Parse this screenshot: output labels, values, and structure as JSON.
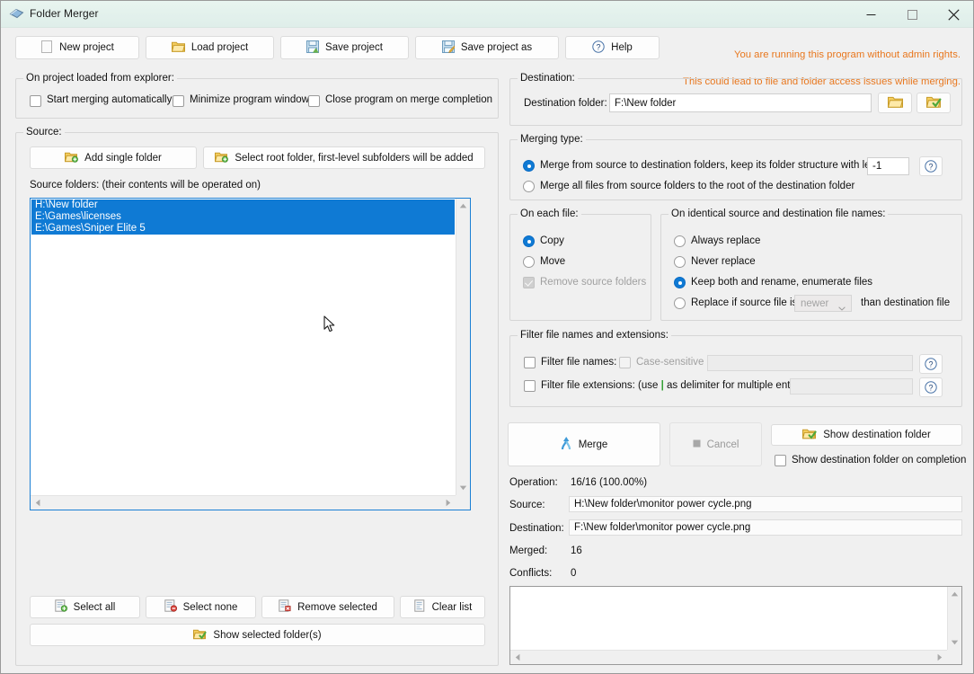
{
  "window": {
    "title": "Folder Merger",
    "icon": "folder-merger-icon",
    "minimize": "minimize-icon",
    "maximize": "maximize-icon",
    "close": "close-icon"
  },
  "toolbar": {
    "new_project": "New project",
    "load_project": "Load project",
    "save_project": "Save project",
    "save_project_as": "Save project as",
    "help": "Help"
  },
  "warning": {
    "line1": "You are running this program without admin rights.",
    "line2": "This could lead to file and folder access issues while merging.",
    "color": "#e8771e"
  },
  "on_project_loaded": {
    "legend": "On project loaded from explorer:",
    "options": [
      {
        "label": "Start merging automatically",
        "checked": false
      },
      {
        "label": "Minimize program window",
        "checked": false
      },
      {
        "label": "Close program on merge completion",
        "checked": false
      }
    ]
  },
  "source": {
    "legend": "Source:",
    "add_single_folder": "Add single folder",
    "select_root_folder": "Select root folder, first-level subfolders will be added",
    "list_label": "Source folders: (their contents will be operated on)",
    "folders": [
      {
        "path": "H:\\New folder",
        "selected": true
      },
      {
        "path": "E:\\Games\\licenses",
        "selected": true
      },
      {
        "path": "E:\\Games\\Sniper Elite 5",
        "selected": true
      }
    ],
    "buttons": {
      "select_all": "Select all",
      "select_none": "Select none",
      "remove_selected": "Remove selected",
      "clear_list": "Clear list",
      "show_selected": "Show selected folder(s)"
    }
  },
  "destination": {
    "legend": "Destination:",
    "label": "Destination folder:",
    "value": "F:\\New folder",
    "browse_icon": "open-folder-icon",
    "show_icon": "folder-check-icon"
  },
  "merging_type": {
    "legend": "Merging type:",
    "options": [
      {
        "label": "Merge from source to destination folders, keep its folder structure with level:",
        "selected": true
      },
      {
        "label": "Merge all files from source folders to the root of the destination folder",
        "selected": false
      }
    ],
    "level_value": "-1",
    "help": "?"
  },
  "on_each_file": {
    "legend": "On each file:",
    "options": [
      {
        "label": "Copy",
        "selected": true
      },
      {
        "label": "Move",
        "selected": false
      }
    ],
    "remove_source_folders": {
      "label": "Remove source folders",
      "checked": true,
      "enabled": false
    }
  },
  "on_identical": {
    "legend": "On identical source and destination file names:",
    "options": [
      {
        "label": "Always replace",
        "selected": false
      },
      {
        "label": "Never replace",
        "selected": false
      },
      {
        "label": "Keep both and rename, enumerate files",
        "selected": true
      },
      {
        "label": "Replace if source file is",
        "selected": false
      }
    ],
    "compare_value": "newer",
    "compare_suffix": "than destination file"
  },
  "filters": {
    "legend": "Filter file names and extensions:",
    "file_names": {
      "label": "Filter file names:",
      "checked": false,
      "value": ""
    },
    "case_sensitive": {
      "label": "Case-sensitive",
      "checked": false,
      "enabled": false
    },
    "file_extensions": {
      "label_a": "Filter file extensions: (use ",
      "delimiter": "|",
      "label_b": " as delimiter for multiple entries)",
      "checked": false,
      "value": ""
    },
    "help": "?"
  },
  "actions": {
    "merge": "Merge",
    "cancel": "Cancel",
    "show_destination_folder": "Show destination folder",
    "show_destination_on_completion": {
      "label": "Show destination folder on completion",
      "checked": false
    }
  },
  "status": {
    "operation_label": "Operation:",
    "operation_value": "16/16 (100.00%)",
    "source_label": "Source:",
    "source_value": "H:\\New folder\\monitor power cycle.png",
    "destination_label": "Destination:",
    "destination_value": "F:\\New folder\\monitor power cycle.png",
    "merged_label": "Merged:",
    "merged_value": "16",
    "conflicts_label": "Conflicts:",
    "conflicts_value": "0"
  },
  "log": {
    "text": ""
  }
}
